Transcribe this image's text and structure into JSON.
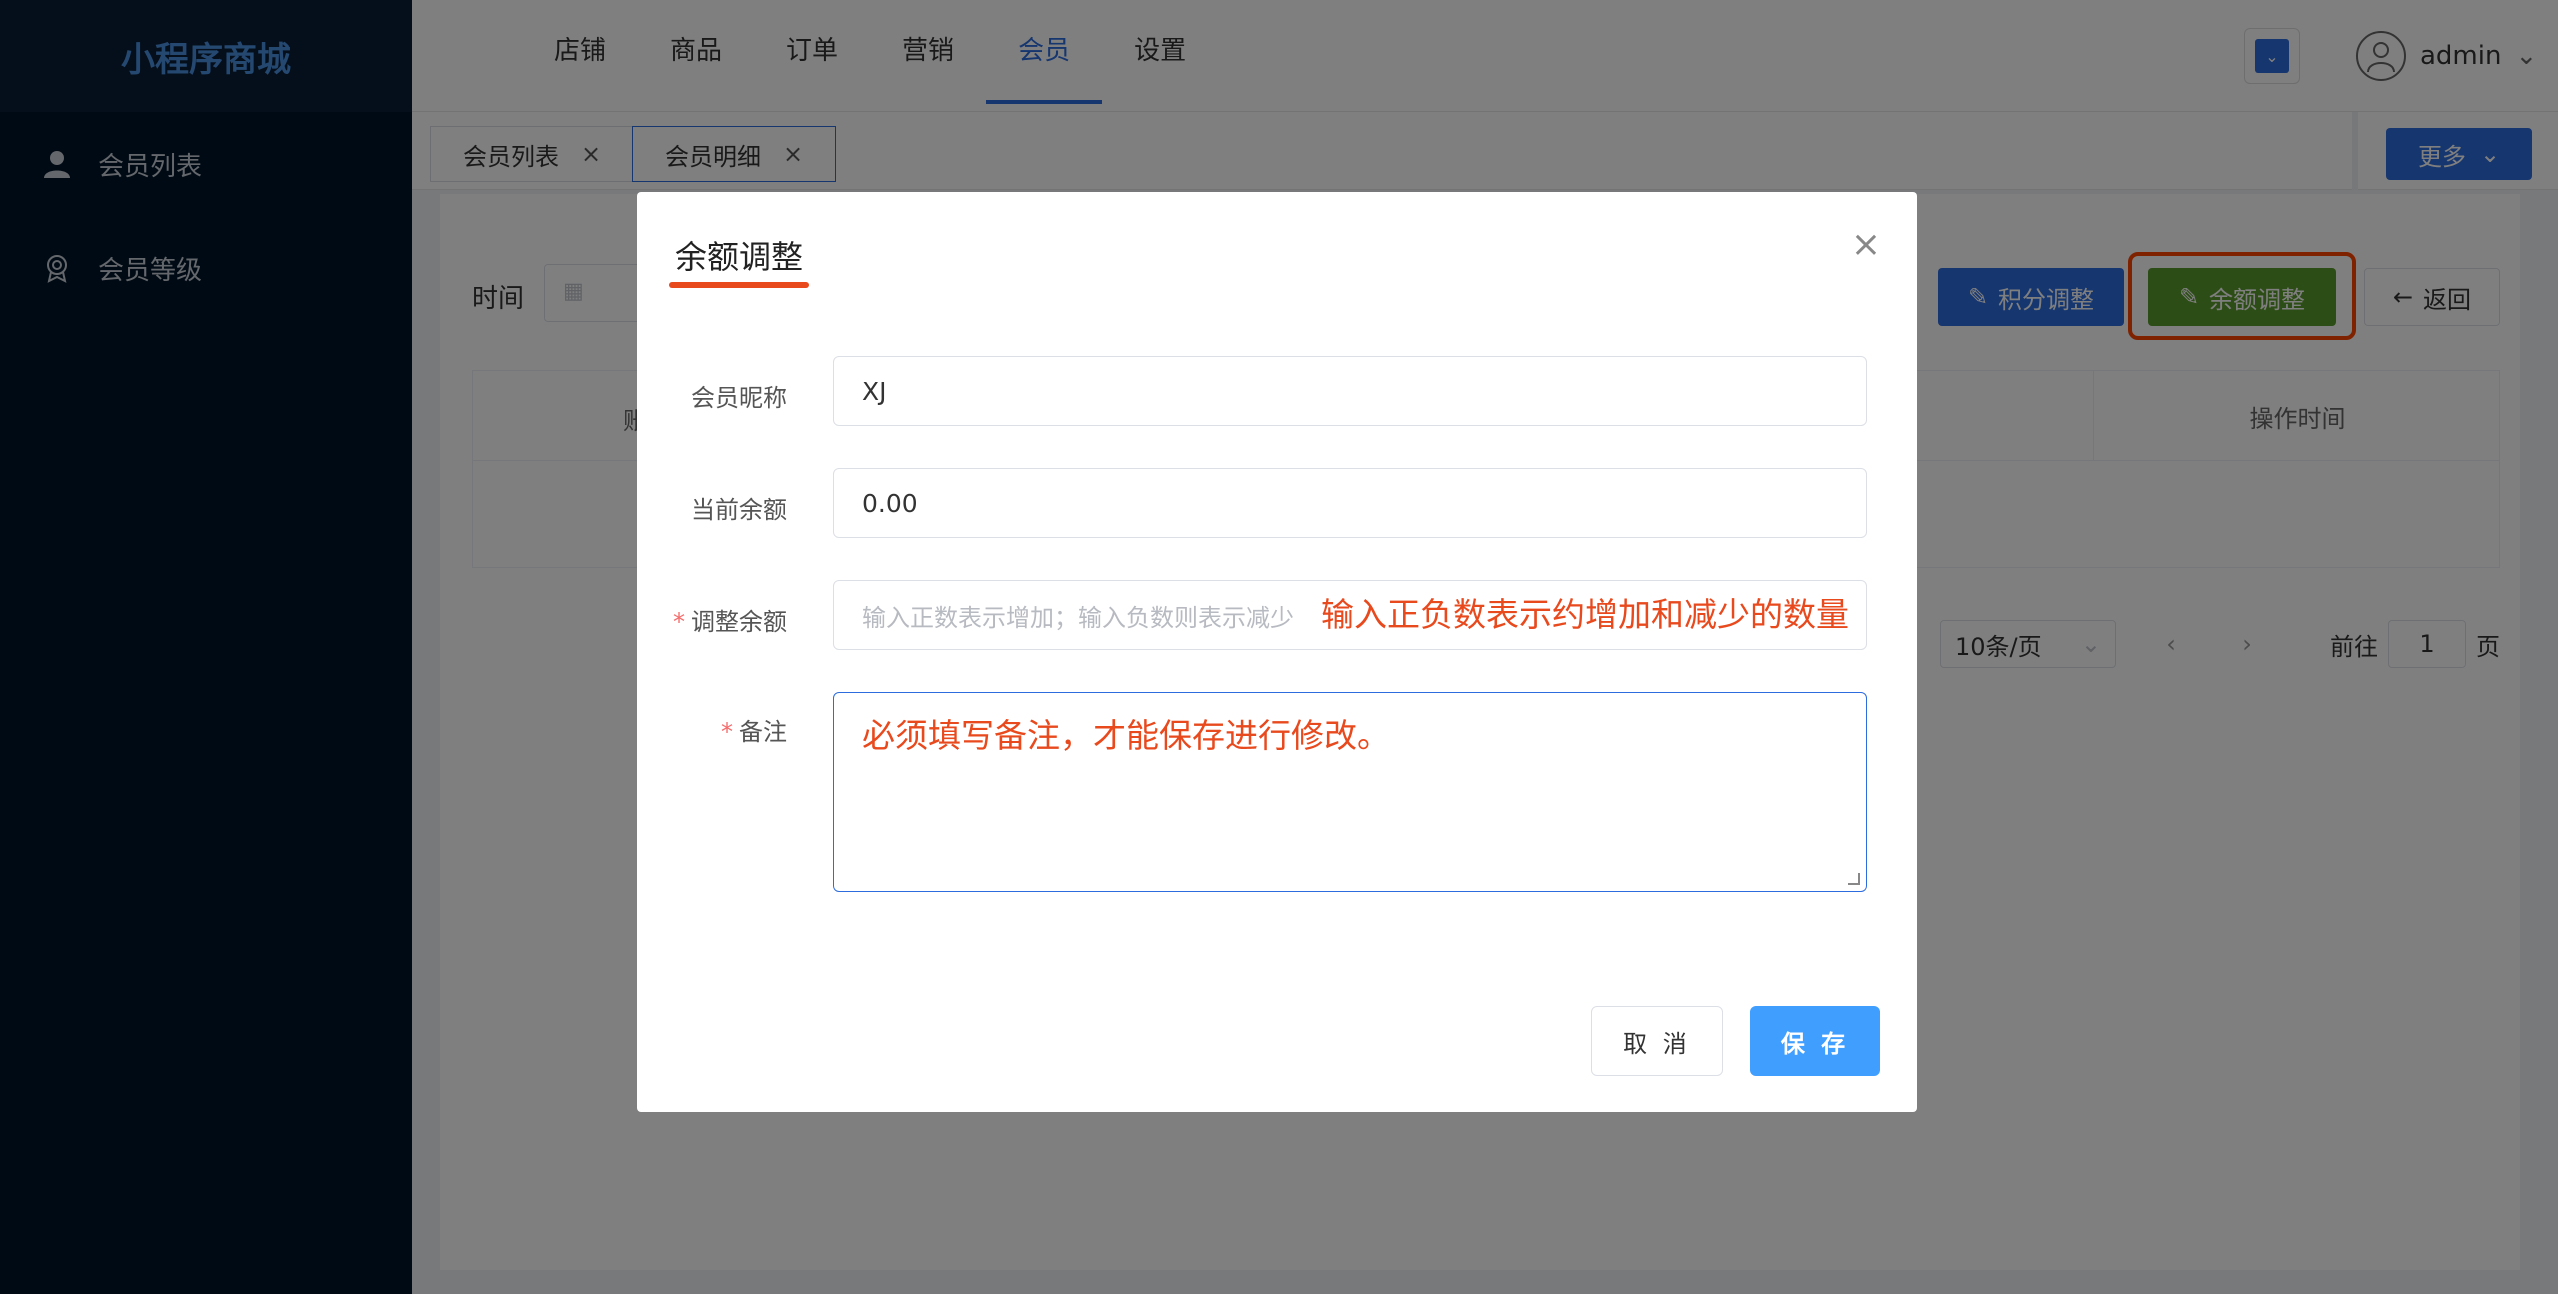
{
  "sidebar": {
    "logo": "小程序商城",
    "items": [
      {
        "label": "会员列表"
      },
      {
        "label": "会员等级"
      }
    ]
  },
  "header": {
    "nav": [
      "店铺",
      "商品",
      "订单",
      "营销",
      "会员",
      "设置"
    ],
    "active_nav": "会员",
    "user": "admin"
  },
  "tabs": [
    {
      "label": "会员列表",
      "close": "×"
    },
    {
      "label": "会员明细",
      "close": "×"
    }
  ],
  "toolbar": {
    "more": "更多",
    "time_label": "时间",
    "points_adjust": "积分调整",
    "balance_adjust": "余额调整",
    "back": "返回"
  },
  "table": {
    "header_left": "账",
    "header_right": "操作时间"
  },
  "pager": {
    "page_size": "10条/页",
    "goto": "前往",
    "page": "1",
    "page_unit": "页"
  },
  "modal": {
    "title": "余额调整",
    "fields": {
      "nickname_label": "会员昵称",
      "nickname_value": "XJ",
      "current_balance_label": "当前余额",
      "current_balance_value": "0.00",
      "adjust_label": "调整余额",
      "adjust_placeholder": "输入正数表示增加；输入负数则表示减少",
      "remark_label": "备注",
      "remark_value": "必须填写备注，才能保存进行修改。"
    },
    "annotation": "输入正负数表示约增加和减少的数量",
    "cancel": "取 消",
    "save": "保 存"
  },
  "colors": {
    "sidebar_bg": "#001529",
    "accent_blue": "#2d6cdf",
    "balance_green": "#5a9a2c",
    "annotation_red": "#e8491d"
  }
}
